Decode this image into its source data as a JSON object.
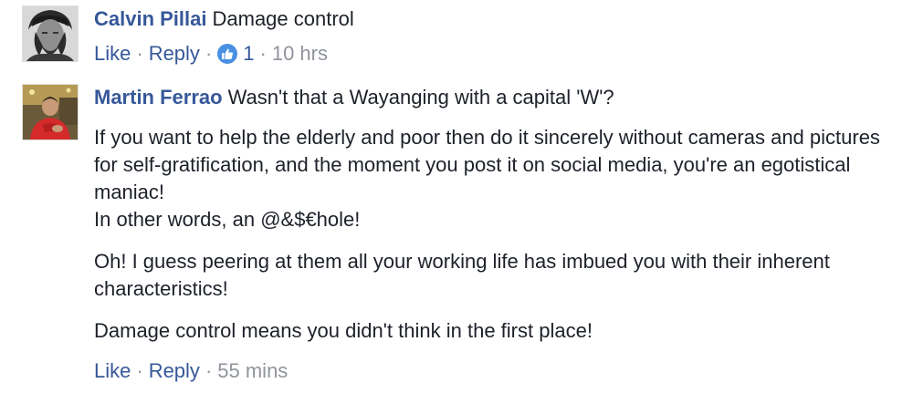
{
  "comments": [
    {
      "author": "Calvin Pillai",
      "text": "Damage control",
      "actions": {
        "like": "Like",
        "reply": "Reply",
        "reaction_count": "1",
        "time": "10 hrs"
      }
    },
    {
      "author": "Martin Ferrao",
      "text": "Wasn't that a Wayanging with a capital 'W'?",
      "paragraphs": [
        "If you want to help the elderly and poor then do it sincerely without cameras and pictures for self-gratification, and the moment you post it on social media, you're an egotistical maniac!",
        "In other words, an @&$€hole!",
        "Oh! I guess peering at them all your working life has imbued you with their inherent characteristics!",
        "Damage control means you didn't think in the first place!"
      ],
      "actions": {
        "like": "Like",
        "reply": "Reply",
        "time": "55 mins"
      }
    }
  ],
  "separator": "·",
  "colors": {
    "author": "#365899",
    "link": "#365899",
    "meta": "#90949c",
    "text": "#1d2129",
    "like_badge": "#4a90e2"
  }
}
